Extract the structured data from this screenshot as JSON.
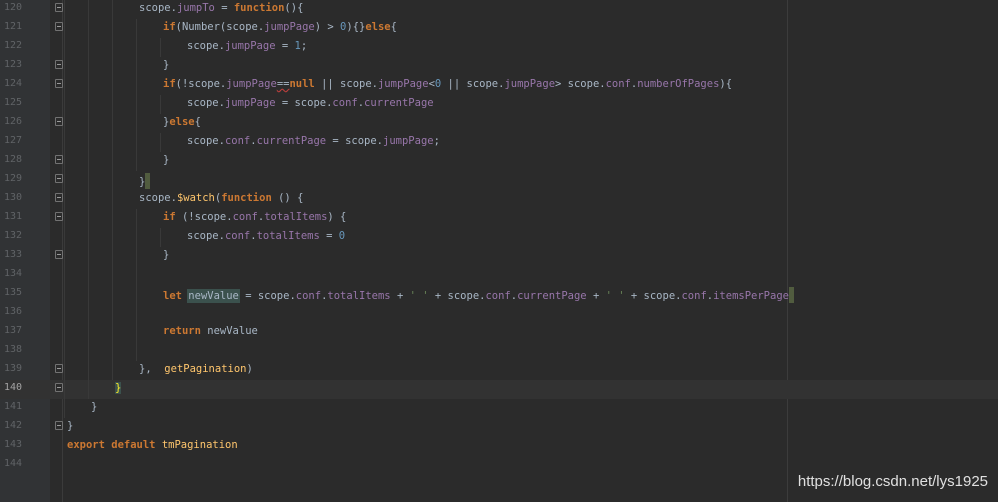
{
  "editor": {
    "lines": [
      {
        "no": "120",
        "indent": 139,
        "fold": true,
        "tokens": [
          [
            "plain",
            "scope."
          ],
          [
            "prop",
            "jumpTo"
          ],
          [
            "plain",
            " = "
          ],
          [
            "kw",
            "function"
          ],
          [
            "plain",
            "(){"
          ]
        ]
      },
      {
        "no": "121",
        "indent": 163,
        "fold": true,
        "tokens": [
          [
            "kw",
            "if"
          ],
          [
            "plain",
            "(Number(scope."
          ],
          [
            "prop",
            "jumpPage"
          ],
          [
            "plain",
            ") > "
          ],
          [
            "num",
            "0"
          ],
          [
            "plain",
            "){}"
          ],
          [
            "kw",
            "else"
          ],
          [
            "plain",
            "{"
          ]
        ]
      },
      {
        "no": "122",
        "indent": 187,
        "fold": false,
        "tokens": [
          [
            "plain",
            "scope."
          ],
          [
            "prop",
            "jumpPage"
          ],
          [
            "plain",
            " = "
          ],
          [
            "num",
            "1"
          ],
          [
            "plain",
            ";"
          ]
        ]
      },
      {
        "no": "123",
        "indent": 163,
        "fold": true,
        "tokens": [
          [
            "plain",
            "}"
          ]
        ]
      },
      {
        "no": "124",
        "indent": 163,
        "fold": true,
        "tokens": [
          [
            "kw",
            "if"
          ],
          [
            "plain",
            "(!scope."
          ],
          [
            "prop",
            "jumpPage"
          ],
          [
            "squiggle",
            "=="
          ],
          [
            "kw",
            "null"
          ],
          [
            "plain",
            " || scope."
          ],
          [
            "prop",
            "jumpPage"
          ],
          [
            "plain",
            "<"
          ],
          [
            "num",
            "0"
          ],
          [
            "plain",
            " || scope."
          ],
          [
            "prop",
            "jumpPage"
          ],
          [
            "plain",
            "> scope."
          ],
          [
            "prop",
            "conf"
          ],
          [
            "plain",
            "."
          ],
          [
            "prop",
            "numberOfPages"
          ],
          [
            "plain",
            "){"
          ]
        ]
      },
      {
        "no": "125",
        "indent": 187,
        "fold": false,
        "tokens": [
          [
            "plain",
            "scope."
          ],
          [
            "prop",
            "jumpPage"
          ],
          [
            "plain",
            " = scope."
          ],
          [
            "prop",
            "conf"
          ],
          [
            "plain",
            "."
          ],
          [
            "prop",
            "currentPage"
          ]
        ]
      },
      {
        "no": "126",
        "indent": 163,
        "fold": true,
        "tokens": [
          [
            "plain",
            "}"
          ],
          [
            "kw",
            "else"
          ],
          [
            "plain",
            "{"
          ]
        ]
      },
      {
        "no": "127",
        "indent": 187,
        "fold": false,
        "tokens": [
          [
            "plain",
            "scope."
          ],
          [
            "prop",
            "conf"
          ],
          [
            "plain",
            "."
          ],
          [
            "prop",
            "currentPage"
          ],
          [
            "plain",
            " = scope."
          ],
          [
            "prop",
            "jumpPage"
          ],
          [
            "plain",
            ";"
          ]
        ]
      },
      {
        "no": "128",
        "indent": 163,
        "fold": true,
        "tokens": [
          [
            "plain",
            "}"
          ]
        ]
      },
      {
        "no": "129",
        "indent": 139,
        "fold": true,
        "tokens": [
          [
            "plain",
            "}"
          ],
          [
            "caret",
            ""
          ]
        ]
      },
      {
        "no": "130",
        "indent": 139,
        "fold": true,
        "tokens": [
          [
            "plain",
            "scope."
          ],
          [
            "fn",
            "$watch"
          ],
          [
            "plain",
            "("
          ],
          [
            "kw",
            "function"
          ],
          [
            "plain",
            " () {"
          ]
        ]
      },
      {
        "no": "131",
        "indent": 163,
        "fold": true,
        "tokens": [
          [
            "kw",
            "if"
          ],
          [
            "plain",
            " (!scope."
          ],
          [
            "prop",
            "conf"
          ],
          [
            "plain",
            "."
          ],
          [
            "prop",
            "totalItems"
          ],
          [
            "plain",
            ") {"
          ]
        ]
      },
      {
        "no": "132",
        "indent": 187,
        "fold": false,
        "tokens": [
          [
            "plain",
            "scope."
          ],
          [
            "prop",
            "conf"
          ],
          [
            "plain",
            "."
          ],
          [
            "prop",
            "totalItems"
          ],
          [
            "plain",
            " = "
          ],
          [
            "num",
            "0"
          ]
        ]
      },
      {
        "no": "133",
        "indent": 163,
        "fold": true,
        "tokens": [
          [
            "plain",
            "}"
          ]
        ]
      },
      {
        "no": "134",
        "indent": 163,
        "fold": false,
        "tokens": []
      },
      {
        "no": "135",
        "indent": 163,
        "fold": false,
        "tokens": [
          [
            "kw",
            "let"
          ],
          [
            "plain",
            " "
          ],
          [
            "hl",
            "newValue"
          ],
          [
            "plain",
            " = scope."
          ],
          [
            "prop",
            "conf"
          ],
          [
            "plain",
            "."
          ],
          [
            "prop",
            "totalItems"
          ],
          [
            "plain",
            " + "
          ],
          [
            "str",
            "' '"
          ],
          [
            "plain",
            " + scope."
          ],
          [
            "prop",
            "conf"
          ],
          [
            "plain",
            "."
          ],
          [
            "prop",
            "currentPage"
          ],
          [
            "plain",
            " + "
          ],
          [
            "str",
            "' '"
          ],
          [
            "plain",
            " + scope."
          ],
          [
            "prop",
            "conf"
          ],
          [
            "plain",
            "."
          ],
          [
            "prop",
            "itemsPerPage"
          ],
          [
            "caret",
            ""
          ]
        ]
      },
      {
        "no": "136",
        "indent": 163,
        "fold": false,
        "tokens": []
      },
      {
        "no": "137",
        "indent": 163,
        "fold": false,
        "tokens": [
          [
            "kw",
            "return"
          ],
          [
            "plain",
            " newValue"
          ]
        ]
      },
      {
        "no": "138",
        "indent": 163,
        "fold": false,
        "tokens": []
      },
      {
        "no": "139",
        "indent": 139,
        "fold": true,
        "tokens": [
          [
            "plain",
            "},  "
          ],
          [
            "fn",
            "getPagination"
          ],
          [
            "plain",
            ")"
          ]
        ]
      },
      {
        "no": "140",
        "indent": 115,
        "fold": true,
        "current": true,
        "tokens": [
          [
            "brace",
            "}"
          ]
        ]
      },
      {
        "no": "141",
        "indent": 91,
        "fold": false,
        "tokens": [
          [
            "plain",
            "}"
          ]
        ]
      },
      {
        "no": "142",
        "indent": 67,
        "fold": true,
        "tokens": [
          [
            "plain",
            "}"
          ]
        ]
      },
      {
        "no": "143",
        "indent": 67,
        "fold": false,
        "tokens": [
          [
            "kw",
            "export default "
          ],
          [
            "fn",
            "tmPagination"
          ]
        ]
      },
      {
        "no": "144",
        "indent": 67,
        "fold": false,
        "tokens": []
      }
    ]
  },
  "watermark": {
    "url": "https://blog.csdn.net/lys1925"
  },
  "colors": {
    "background": "#2b2b2b",
    "keyword": "#cc7832",
    "property": "#9876aa",
    "function": "#ffc66d",
    "number": "#6897bb",
    "string": "#6a8759",
    "plain": "#a9b7c6"
  }
}
